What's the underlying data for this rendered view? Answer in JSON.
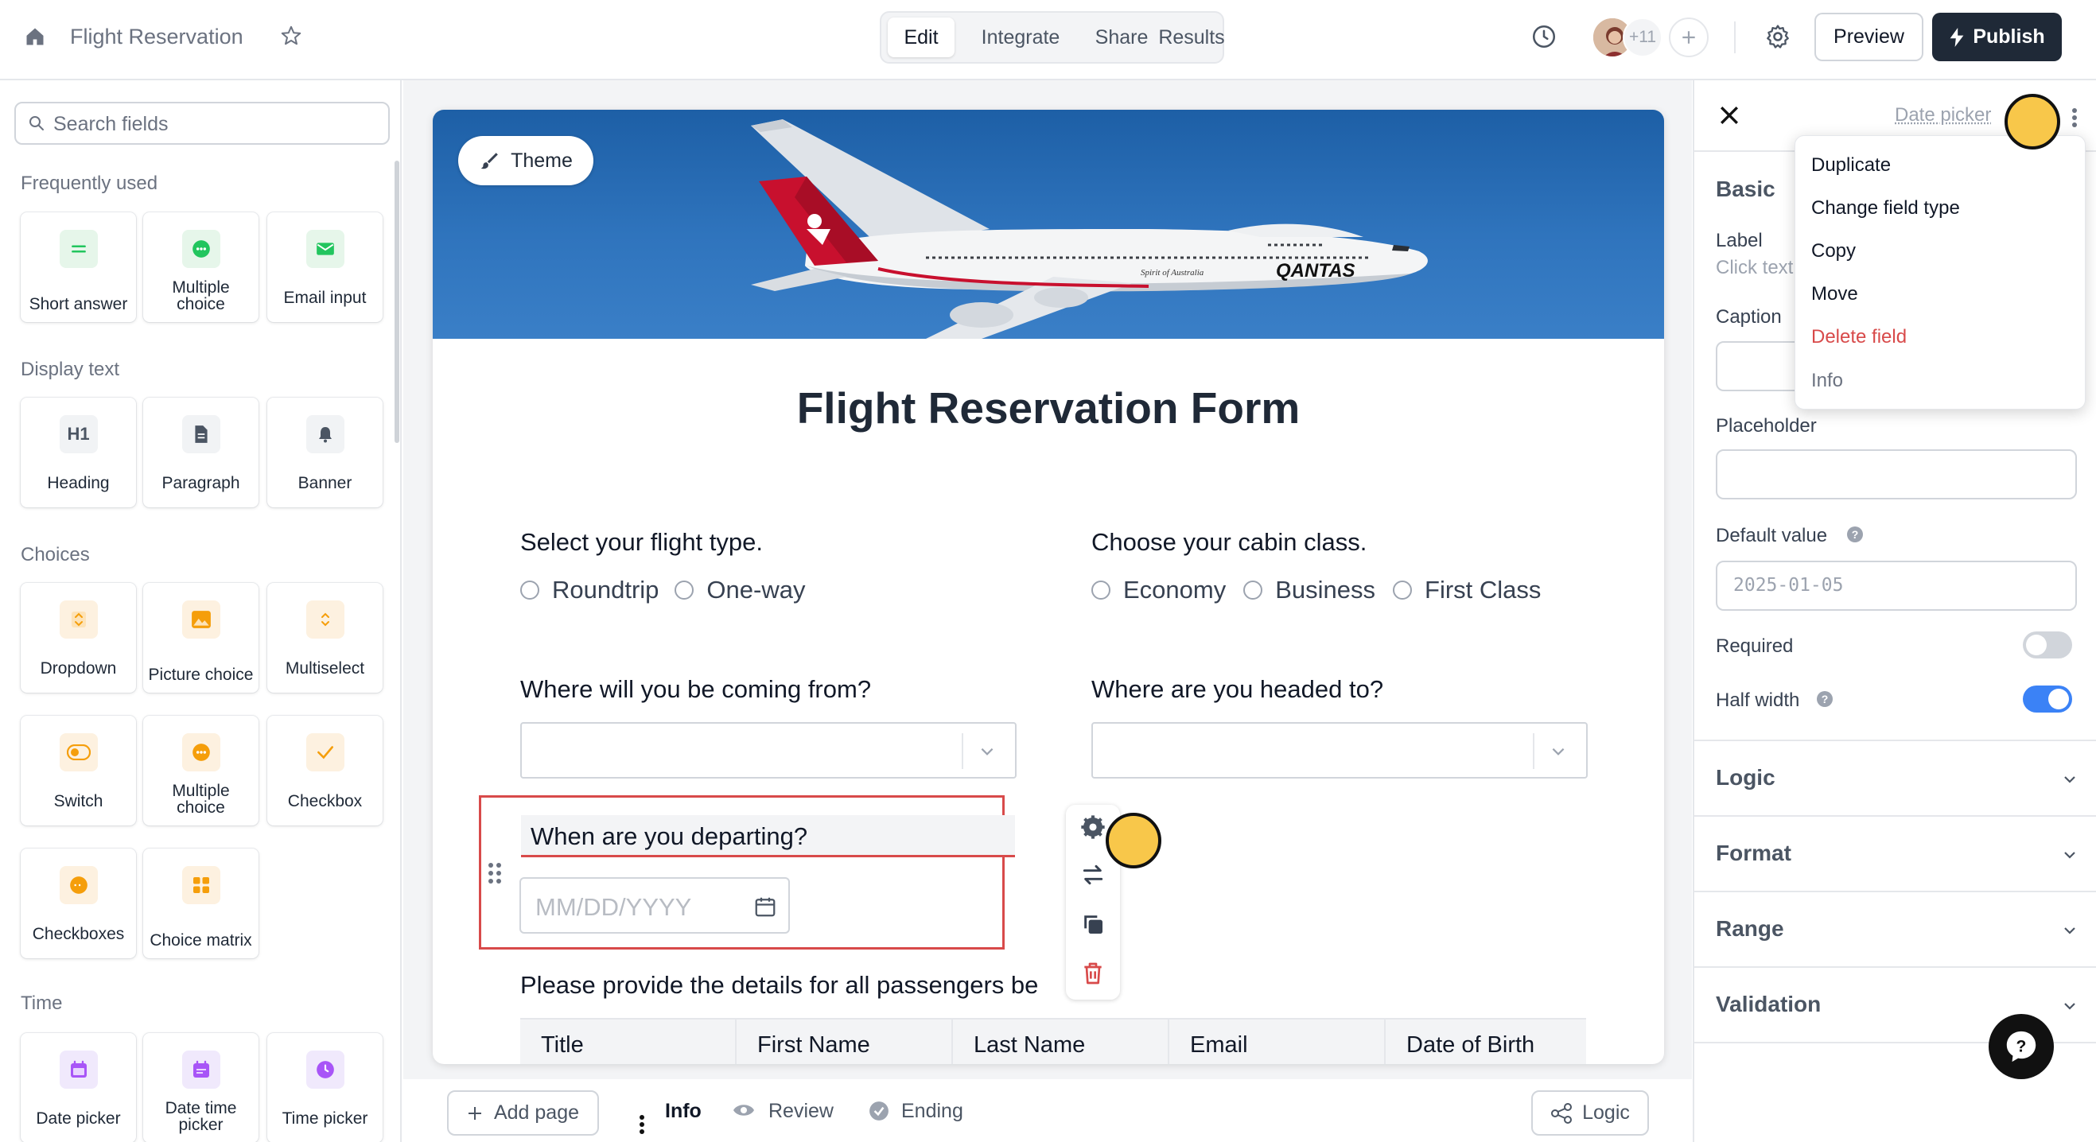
{
  "header": {
    "title": "Flight Reservation",
    "tabs": [
      {
        "label": "Edit",
        "active": true
      },
      {
        "label": "Integrate",
        "active": false
      },
      {
        "label": "Share",
        "active": false
      },
      {
        "label": "Results",
        "active": false
      }
    ],
    "collaborators_extra": "+11",
    "preview_label": "Preview",
    "publish_label": "Publish"
  },
  "sidebar": {
    "search_placeholder": "Search fields",
    "sections": {
      "frequent": "Frequently used",
      "display": "Display text",
      "choices": "Choices",
      "time": "Time"
    },
    "frequent": [
      {
        "label": "Short answer",
        "icon": "short-answer-icon"
      },
      {
        "label": "Multiple choice",
        "icon": "multiple-choice-icon"
      },
      {
        "label": "Email input",
        "icon": "email-icon"
      }
    ],
    "display": [
      {
        "label": "Heading",
        "icon": "heading-icon"
      },
      {
        "label": "Paragraph",
        "icon": "paragraph-icon"
      },
      {
        "label": "Banner",
        "icon": "bell-icon"
      }
    ],
    "choices": [
      {
        "label": "Dropdown",
        "icon": "dropdown-icon"
      },
      {
        "label": "Picture choice",
        "icon": "picture-icon"
      },
      {
        "label": "Multiselect",
        "icon": "multiselect-icon"
      },
      {
        "label": "Switch",
        "icon": "switch-icon"
      },
      {
        "label": "Multiple choice",
        "icon": "multiple-choice-icon"
      },
      {
        "label": "Checkbox",
        "icon": "checkbox-icon"
      },
      {
        "label": "Checkboxes",
        "icon": "checkboxes-icon"
      },
      {
        "label": "Choice matrix",
        "icon": "choice-matrix-icon"
      }
    ],
    "time": [
      {
        "label": "Date picker",
        "icon": "calendar-icon"
      },
      {
        "label": "Date time picker",
        "icon": "calendar-icon"
      },
      {
        "label": "Time picker",
        "icon": "clock-icon"
      }
    ]
  },
  "form": {
    "theme_label": "Theme",
    "title": "Flight Reservation Form",
    "flight_type": {
      "question": "Select your flight type.",
      "options": [
        "Roundtrip",
        "One-way"
      ]
    },
    "cabin_class": {
      "question": "Choose your cabin class.",
      "options": [
        "Economy",
        "Business",
        "First Class"
      ]
    },
    "origin_question": "Where will you be coming from?",
    "destination_question": "Where are you headed to?",
    "departure": {
      "question": "When are you departing?",
      "placeholder": "MM/DD/YYYY"
    },
    "passengers_question": "Please provide the details for all passengers be",
    "table_headers": [
      "Title",
      "First Name",
      "Last Name",
      "Email",
      "Date of Birth"
    ],
    "banner_airline": "QANTAS",
    "banner_small": "Spirit of Australia"
  },
  "bottom": {
    "add_page": "Add page",
    "pages": [
      "Info",
      "Review",
      "Ending"
    ],
    "logic": "Logic"
  },
  "panel": {
    "field_type": "Date picker",
    "basic_heading": "Basic",
    "label_label": "Label",
    "label_hint": "Click text",
    "caption_label": "Caption",
    "placeholder_label": "Placeholder",
    "default_value_label": "Default value",
    "default_value": "2025-01-05",
    "required_label": "Required",
    "required_on": false,
    "half_width_label": "Half width",
    "half_width_on": true,
    "sections": [
      "Logic",
      "Format",
      "Range",
      "Validation"
    ],
    "menu": [
      "Duplicate",
      "Change field type",
      "Copy",
      "Move",
      "Delete field",
      "Info"
    ]
  },
  "colors": {
    "accent_blue": "#3b82f6",
    "danger_red": "#d84a4a",
    "cursor_yellow": "#f8c74a",
    "green": "#22c55e",
    "orange": "#f59e0b",
    "purple": "#a855f7"
  }
}
